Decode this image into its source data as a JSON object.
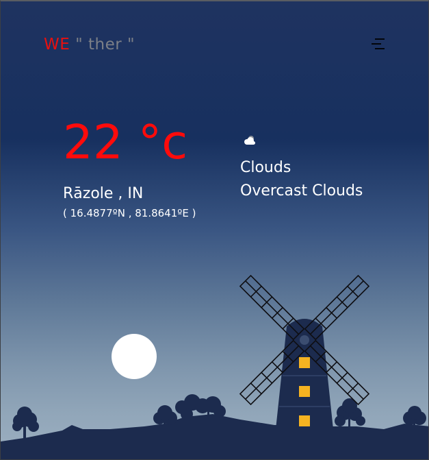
{
  "header": {
    "logo_we": "WE",
    "logo_rest": " \" ther \"",
    "menu_icon": "menu-icon"
  },
  "current": {
    "temperature": "22 °c",
    "location": "Rāzole , IN",
    "coordinates": "( 16.4877ºN , 81.8641ºE )",
    "condition": "Clouds",
    "description": "Overcast Clouds",
    "weather_icon": "cloud-icon"
  },
  "colors": {
    "accent": "#ff0b0b",
    "logo_grey": "#7b7f87",
    "text": "#ffffff",
    "sky_top": "#1f3360",
    "sky_bottom": "#9db0c1",
    "silhouette": "#1c2b4e",
    "window": "#f5b321",
    "moon": "#ffffff"
  }
}
